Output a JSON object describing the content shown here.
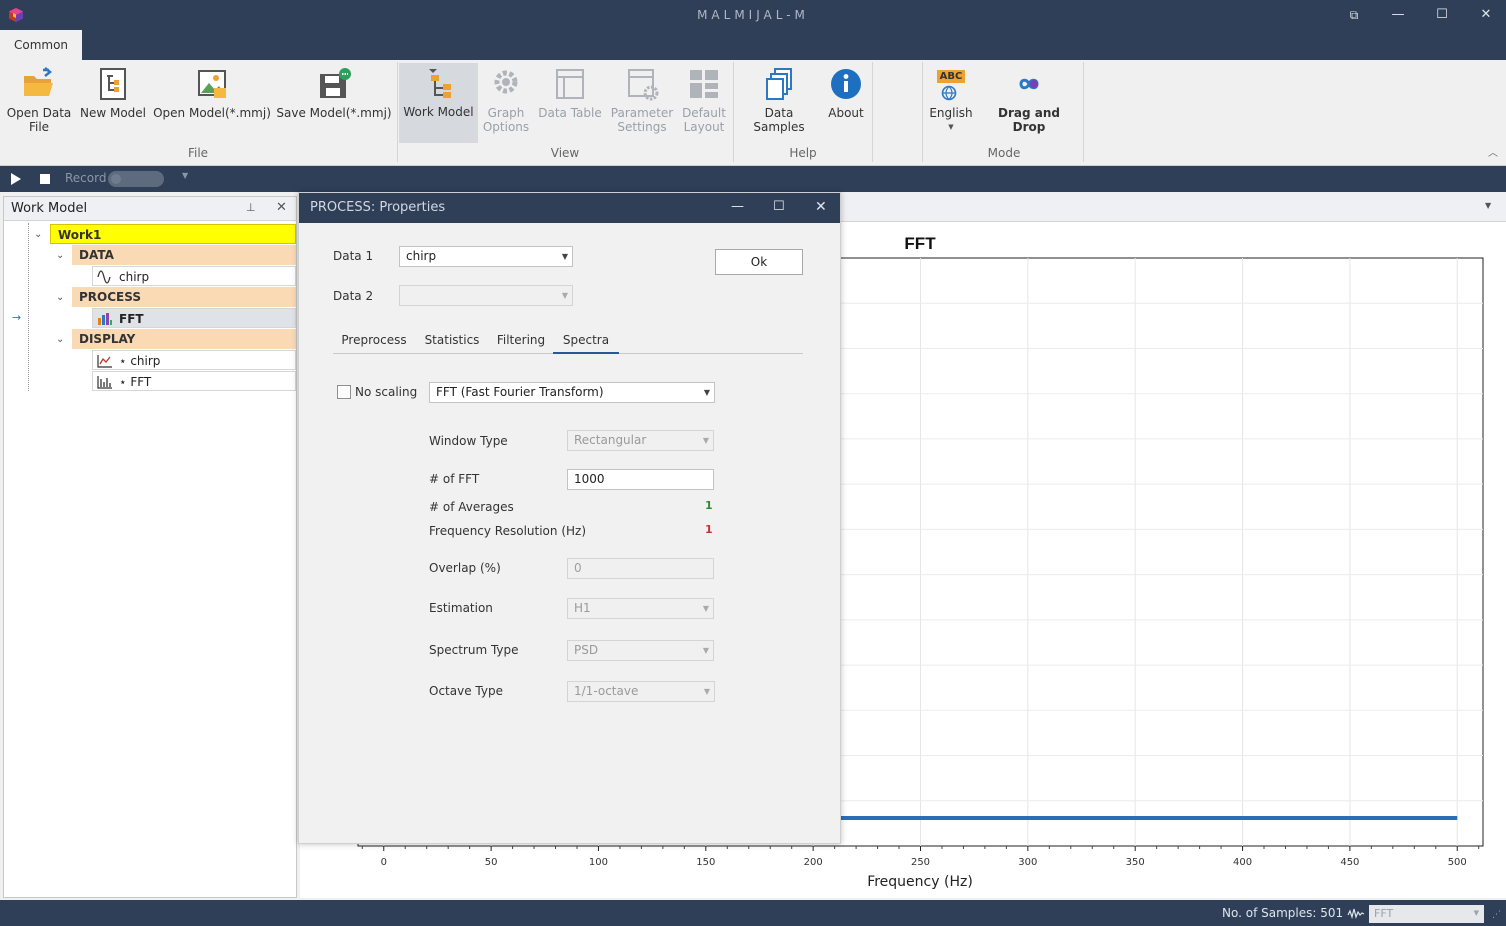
{
  "app": {
    "title": "MALMIJAL-M",
    "window_controls": {
      "restore_alt": "⧉",
      "minimize": "—",
      "maximize": "☐",
      "close": "✕"
    }
  },
  "ribbon": {
    "tab": "Common",
    "file": {
      "label": "File",
      "open_data_line1": "Open Data",
      "open_data_line2": "File",
      "new_model": "New Model",
      "open_model": "Open Model(*.mmj)",
      "save_model": "Save Model(*.mmj)"
    },
    "view": {
      "label": "View",
      "work_model": "Work Model",
      "graph_options_1": "Graph",
      "graph_options_2": "Options",
      "data_table": "Data Table",
      "parameter_settings_1": "Parameter",
      "parameter_settings_2": "Settings",
      "default_layout_1": "Default",
      "default_layout_2": "Layout"
    },
    "help": {
      "label": "Help",
      "data_samples": "Data Samples",
      "about": "About"
    },
    "mode": {
      "label": "Mode",
      "english": "English",
      "abc_badge": "ABC",
      "drag_and_drop": "Drag and Drop"
    }
  },
  "record_bar": {
    "record": "Record"
  },
  "work_model": {
    "title": "Work Model",
    "work": "Work1",
    "data_group": "DATA",
    "data_item": "chirp",
    "process_group": "PROCESS",
    "process_item": "FFT",
    "display_group": "DISPLAY",
    "display_item_1": "⋆ chirp",
    "display_item_2": "⋆ FFT"
  },
  "dialog": {
    "title": "PROCESS: Properties",
    "data1_label": "Data 1",
    "data1_value": "chirp",
    "data2_label": "Data 2",
    "data2_value": "",
    "ok": "Ok",
    "tabs": [
      "Preprocess",
      "Statistics",
      "Filtering",
      "Spectra"
    ],
    "active_tab": "Spectra",
    "no_scaling": "No scaling",
    "method": "FFT (Fast Fourier Transform)",
    "window_type_label": "Window Type",
    "window_type": "Rectangular",
    "nfft_label": "# of FFT",
    "nfft": "1000",
    "averages_label": "# of Averages",
    "averages": "1",
    "freq_res_label": "Frequency Resolution (Hz)",
    "freq_res": "1",
    "overlap_label": "Overlap (%)",
    "overlap": "0",
    "estimation_label": "Estimation",
    "estimation": "H1",
    "spectrum_type_label": "Spectrum Type",
    "spectrum_type": "PSD",
    "octave_type_label": "Octave Type",
    "octave_type": "1/1-octave"
  },
  "chart_data": {
    "type": "line",
    "title": "FFT",
    "xlabel": "Frequency (Hz)",
    "ylabel": "",
    "xlim": [
      -12,
      512
    ],
    "x_ticks": [
      0,
      50,
      100,
      150,
      200,
      250,
      300,
      350,
      400,
      450,
      500
    ],
    "grid": true,
    "series": [
      {
        "x": [
          200,
          500
        ],
        "y": [
          0,
          0
        ],
        "color": "#2a6fb5"
      }
    ]
  },
  "status": {
    "samples": "No. of Samples: 501",
    "display_select": "FFT"
  },
  "colors": {
    "chrome": "#2f3f57",
    "work_highlight": "#ffff00",
    "group_highlight": "#fad9b5",
    "series": "#2a6fb5"
  }
}
